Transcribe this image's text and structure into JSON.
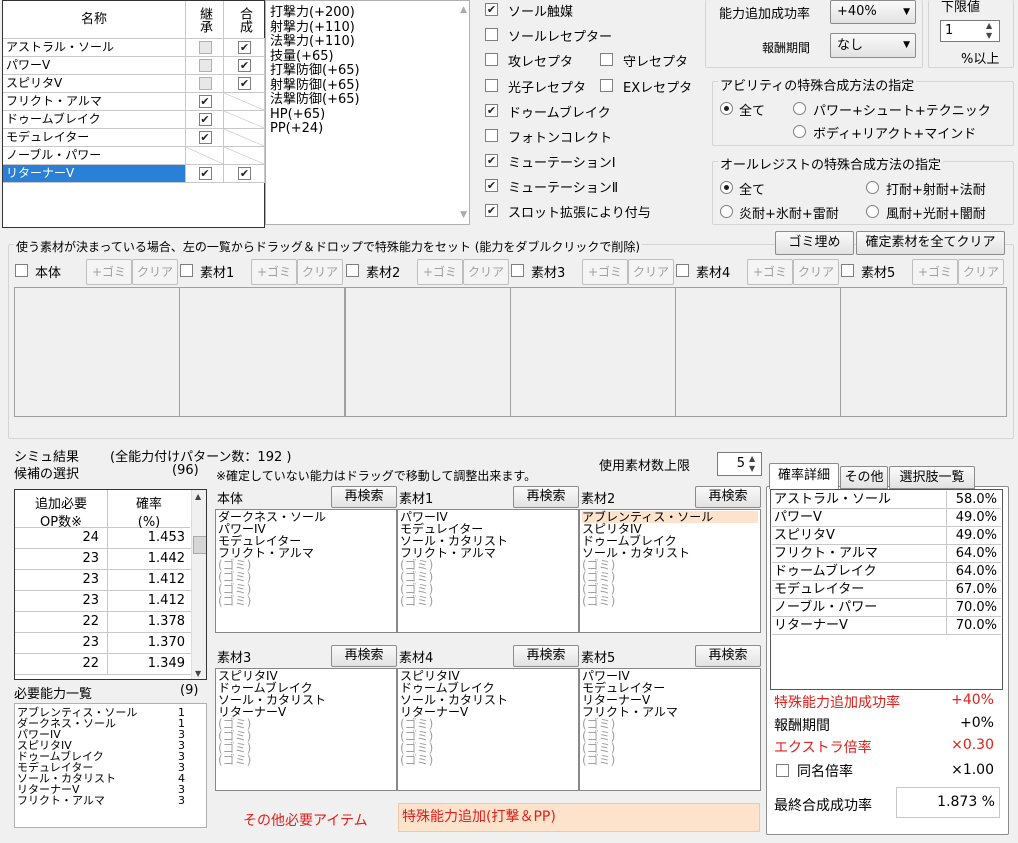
{
  "table": {
    "col_name": "名称",
    "col_inherit": "継承",
    "col_synth": "合成",
    "rows": [
      {
        "name": "アストラル・ソール",
        "inherit": "box",
        "synth": "checked"
      },
      {
        "name": "パワーV",
        "inherit": "box",
        "synth": "checked"
      },
      {
        "name": "スピリタV",
        "inherit": "box",
        "synth": "checked"
      },
      {
        "name": "フリクト・アルマ",
        "inherit": "checked",
        "synth": "none"
      },
      {
        "name": "ドゥームブレイク",
        "inherit": "checked",
        "synth": "none"
      },
      {
        "name": "モデュレイター",
        "inherit": "checked",
        "synth": "none"
      },
      {
        "name": "ノーブル・パワー",
        "inherit": "none",
        "synth": "none"
      },
      {
        "name": "リターナーV",
        "inherit": "checked",
        "synth": "checked"
      }
    ]
  },
  "stats": [
    "打撃力(+200)",
    "射撃力(+110)",
    "法撃力(+110)",
    "技量(+65)",
    "打撃防御(+65)",
    "射撃防御(+65)",
    "法撃防御(+65)",
    "HP(+65)",
    "PP(+24)"
  ],
  "receptors": {
    "sol_catalyst": "ソール触媒",
    "sol_receptor": "ソールレセプター",
    "atk_receptor": "攻レセプタ",
    "def_receptor": "守レセプタ",
    "photon_receptor": "光子レセプタ",
    "ex_receptor": "EXレセプタ",
    "doom_break": "ドゥームブレイク",
    "photon_collect": "フォトンコレクト",
    "mutation1": "ミューテーションⅠ",
    "mutation2": "ミューテーションⅡ",
    "slot_expand": "スロット拡張により付与"
  },
  "boost": {
    "label": "能力追加成功率",
    "value": "+40%",
    "reward_label": "報酬期間",
    "reward_value": "なし"
  },
  "lower": {
    "title": "下限値",
    "value": "1",
    "unit": "%以上"
  },
  "ability_method": {
    "title": "アビリティの特殊合成方法の指定",
    "all": "全て",
    "opt1": "パワー+シュート+テクニック",
    "opt2": "ボディ+リアクト+マインド"
  },
  "resist_method": {
    "title": "オールレジストの特殊合成方法の指定",
    "all": "全て",
    "opt1": "打耐+射耐+法耐",
    "opt2": "炎耐+氷耐+雷耐",
    "opt3": "風耐+光耐+闇耐"
  },
  "material_section": {
    "instruction": "使う素材が決まっている場合、左の一覧からドラッグ＆ドロップで特殊能力をセット (能力をダブルクリックで削除)",
    "fill_junk": "ゴミ埋め",
    "clear_all": "確定素材を全てクリア",
    "junk_btn": "+ゴミ",
    "clear_btn": "クリア",
    "slots": [
      "本体",
      "素材1",
      "素材2",
      "素材3",
      "素材4",
      "素材5"
    ]
  },
  "results": {
    "title": "シミュ結果",
    "pattern": "(全能力付けパターン数：192 )",
    "candidate_label": "候補の選択",
    "candidate_count": "(96)",
    "note": "※確定していない能力はドラッグで移動して調整出来ます。",
    "max_label": "使用素材数上限",
    "max_value": "5",
    "col_op": "追加必要\nOP数※",
    "col_rate": "確率\n(%)",
    "rows": [
      [
        "24",
        "1.453"
      ],
      [
        "23",
        "1.442"
      ],
      [
        "23",
        "1.412"
      ],
      [
        "23",
        "1.412"
      ],
      [
        "22",
        "1.378"
      ],
      [
        "23",
        "1.370"
      ],
      [
        "22",
        "1.349"
      ]
    ]
  },
  "required": {
    "title": "必要能力一覧",
    "count": "(9)",
    "items": [
      [
        "アブレンティス・ソール",
        "1"
      ],
      [
        "ダークネス・ソール",
        "1"
      ],
      [
        "パワーIV",
        "3"
      ],
      [
        "スピリタIV",
        "3"
      ],
      [
        "ドゥームブレイク",
        "3"
      ],
      [
        "モデュレイター",
        "3"
      ],
      [
        "ソール・カタリスト",
        "4"
      ],
      [
        "リターナーV",
        "3"
      ],
      [
        "フリクト・アルマ",
        "3"
      ]
    ]
  },
  "research": "再検索",
  "panes": [
    {
      "title": "本体",
      "items": [
        "ダークネス・ソール",
        "パワーIV",
        "モデュレイター",
        "フリクト・アルマ"
      ],
      "junk": [
        "(ゴミ)",
        "(ゴミ)",
        "(ゴミ)",
        "(ゴミ)"
      ]
    },
    {
      "title": "素材1",
      "items": [
        "パワーIV",
        "モデュレイター",
        "ソール・カタリスト",
        "フリクト・アルマ"
      ],
      "junk": [
        "(ゴミ)",
        "(ゴミ)",
        "(ゴミ)",
        "(ゴミ)"
      ]
    },
    {
      "title": "素材2",
      "items": [
        "アブレンティス・ソール",
        "スピリタIV",
        "ドゥームブレイク",
        "ソール・カタリスト"
      ],
      "junk": [
        "(ゴミ)",
        "(ゴミ)",
        "(ゴミ)",
        "(ゴミ)"
      ]
    },
    {
      "title": "素材3",
      "items": [
        "スピリタIV",
        "ドゥームブレイク",
        "ソール・カタリスト",
        "リターナーV"
      ],
      "junk": [
        "(ゴミ)",
        "(ゴミ)",
        "(ゴミ)",
        "(ゴミ)"
      ]
    },
    {
      "title": "素材4",
      "items": [
        "スピリタIV",
        "ドゥームブレイク",
        "ソール・カタリスト",
        "リターナーV"
      ],
      "junk": [
        "(ゴミ)",
        "(ゴミ)",
        "(ゴミ)",
        "(ゴミ)"
      ]
    },
    {
      "title": "素材5",
      "items": [
        "パワーIV",
        "モデュレイター",
        "リターナーV",
        "フリクト・アルマ"
      ],
      "junk": [
        "(ゴミ)",
        "(ゴミ)",
        "(ゴミ)",
        "(ゴミ)"
      ]
    }
  ],
  "other_items": {
    "label": "その他必要アイテム",
    "value": "特殊能力追加(打撃＆PP)"
  },
  "detail_tabs": [
    "確率詳細",
    "その他",
    "選択肢一覧"
  ],
  "detail_rows": [
    [
      "アストラル・ソール",
      "58.0%"
    ],
    [
      "パワーV",
      "49.0%"
    ],
    [
      "スピリタV",
      "49.0%"
    ],
    [
      "フリクト・アルマ",
      "64.0%"
    ],
    [
      "ドゥームブレイク",
      "64.0%"
    ],
    [
      "モデュレイター",
      "67.0%"
    ],
    [
      "ノーブル・パワー",
      "70.0%"
    ],
    [
      "リターナーV",
      "70.0%"
    ]
  ],
  "summary": {
    "boost_label": "特殊能力追加成功率",
    "boost_value": "+40%",
    "reward_label": "報酬期間",
    "reward_value": "+0%",
    "extra_label": "エクストラ倍率",
    "extra_value": "×0.30",
    "same_label": "同名倍率",
    "same_value": "×1.00",
    "final_label": "最終合成成功率",
    "final_value": "1.873 %"
  },
  "colors": {
    "accent_red": "#e0201b",
    "selection": "#2a7fd6",
    "peach": "#fde3cc"
  }
}
